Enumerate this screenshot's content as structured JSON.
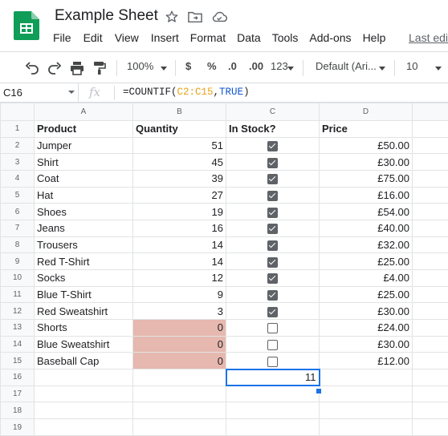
{
  "app": {
    "title": "Example Sheet",
    "menu": [
      "File",
      "Edit",
      "View",
      "Insert",
      "Format",
      "Data",
      "Tools",
      "Add-ons",
      "Help"
    ],
    "last_edit": "Last edi"
  },
  "toolbar": {
    "zoom": "100%",
    "currency": "$",
    "percent": "%",
    "dec_decrease": ".0",
    "dec_increase": ".00",
    "more_formats": "123",
    "font": "Default (Ari...",
    "font_size": "10"
  },
  "formula_bar": {
    "cell_ref": "C16",
    "fx": "fx",
    "formula_prefix": "=COUNTIF(",
    "formula_range": "C2:C15",
    "formula_comma": ",",
    "formula_true": "TRUE",
    "formula_suffix": ")"
  },
  "grid": {
    "columns": [
      "A",
      "B",
      "C",
      "D"
    ],
    "headers": [
      "Product",
      "Quantity",
      "In Stock?",
      "Price"
    ],
    "rows": [
      {
        "product": "Jumper",
        "quantity": "51",
        "in_stock": true,
        "price": "£50.00"
      },
      {
        "product": "Shirt",
        "quantity": "45",
        "in_stock": true,
        "price": "£30.00"
      },
      {
        "product": "Coat",
        "quantity": "39",
        "in_stock": true,
        "price": "£75.00"
      },
      {
        "product": "Hat",
        "quantity": "27",
        "in_stock": true,
        "price": "£16.00"
      },
      {
        "product": "Shoes",
        "quantity": "19",
        "in_stock": true,
        "price": "£54.00"
      },
      {
        "product": "Jeans",
        "quantity": "16",
        "in_stock": true,
        "price": "£40.00"
      },
      {
        "product": "Trousers",
        "quantity": "14",
        "in_stock": true,
        "price": "£32.00"
      },
      {
        "product": "Red T-Shirt",
        "quantity": "14",
        "in_stock": true,
        "price": "£25.00"
      },
      {
        "product": "Socks",
        "quantity": "12",
        "in_stock": true,
        "price": "£4.00"
      },
      {
        "product": "Blue T-Shirt",
        "quantity": "9",
        "in_stock": true,
        "price": "£25.00"
      },
      {
        "product": "Red Sweatshirt",
        "quantity": "3",
        "in_stock": true,
        "price": "£30.00"
      },
      {
        "product": "Shorts",
        "quantity": "0",
        "in_stock": false,
        "price": "£24.00"
      },
      {
        "product": "Blue Sweatshirt",
        "quantity": "0",
        "in_stock": false,
        "price": "£30.00"
      },
      {
        "product": "Baseball Cap",
        "quantity": "0",
        "in_stock": false,
        "price": "£12.00"
      }
    ],
    "result_value": "11",
    "row_numbers": [
      "1",
      "2",
      "3",
      "4",
      "5",
      "6",
      "7",
      "8",
      "9",
      "10",
      "11",
      "12",
      "13",
      "14",
      "15",
      "16",
      "17",
      "18",
      "19"
    ]
  },
  "colors": {
    "zero_quantity_fill": "#e6b8af",
    "selection": "#1a73e8",
    "range_ref": "#e8a317",
    "true_ref": "#1155cc",
    "logo_green": "#0f9d58"
  }
}
